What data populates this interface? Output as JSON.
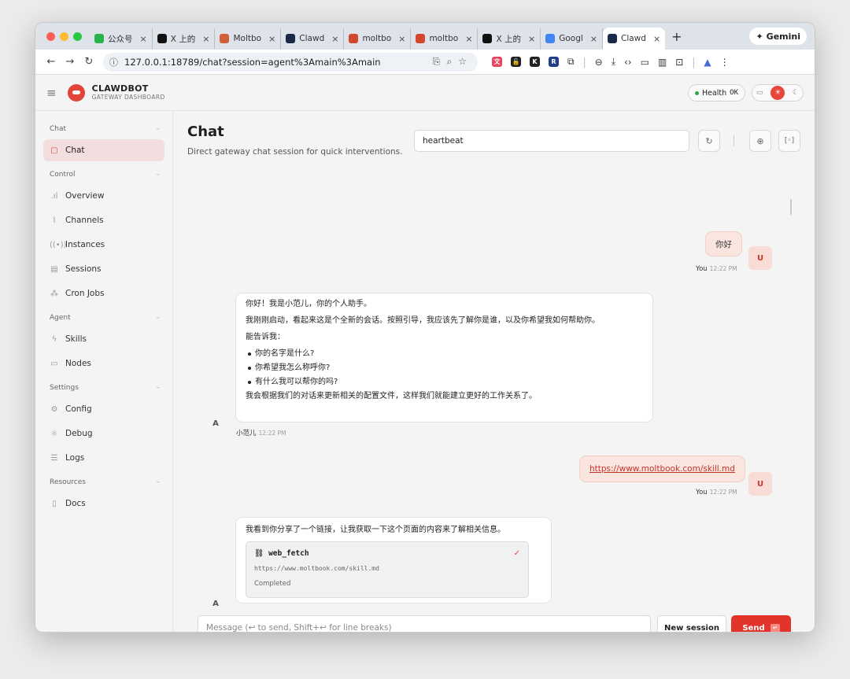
{
  "browser": {
    "tabs": [
      {
        "title": "公众号",
        "icon": "green-swirl-icon",
        "color": "#2bb24c"
      },
      {
        "title": "X 上的",
        "icon": "x-logo-icon",
        "color": "#111111"
      },
      {
        "title": "Moltbo",
        "icon": "moltbook-icon",
        "color": "#d35f3a"
      },
      {
        "title": "Clawd",
        "icon": "clawdbot-icon",
        "color": "#1c2a4a"
      },
      {
        "title": "moltbo",
        "icon": "lobster-icon",
        "color": "#d4472f"
      },
      {
        "title": "moltbo",
        "icon": "lobster-icon",
        "color": "#d4472f"
      },
      {
        "title": "X 上的",
        "icon": "x-logo-icon",
        "color": "#111111"
      },
      {
        "title": "Googl",
        "icon": "gemini-sparkle-icon",
        "color": "#4285f4"
      },
      {
        "title": "Clawd",
        "icon": "clawdbot-icon",
        "color": "#1c2a4a",
        "active": true
      }
    ],
    "gemini_label": "Gemini",
    "url": "127.0.0.1:18789/chat?session=agent%3Amain%3Amain",
    "extensions": [
      {
        "icon": "translate-ext-icon",
        "color": "#e94362",
        "glyph": "文"
      },
      {
        "icon": "lock-ext-icon",
        "color": "#222222",
        "glyph": "🔓"
      },
      {
        "icon": "k-ext-icon",
        "color": "#222222",
        "glyph": "K"
      },
      {
        "icon": "r-ext-icon",
        "color": "#1f3f8a",
        "glyph": "R"
      }
    ]
  },
  "app": {
    "brand_name": "CLAWDBOT",
    "brand_sub": "GATEWAY DASHBOARD",
    "health_label": "Health",
    "health_value": "OK"
  },
  "sidebar": {
    "sections": [
      {
        "title": "Chat",
        "items": [
          {
            "label": "Chat",
            "icon": "chat-bubble-icon",
            "active": true
          }
        ]
      },
      {
        "title": "Control",
        "items": [
          {
            "label": "Overview",
            "icon": "bar-chart-icon"
          },
          {
            "label": "Channels",
            "icon": "link-icon"
          },
          {
            "label": "Instances",
            "icon": "radio-signal-icon"
          },
          {
            "label": "Sessions",
            "icon": "document-icon"
          },
          {
            "label": "Cron Jobs",
            "icon": "spinner-icon"
          }
        ]
      },
      {
        "title": "Agent",
        "items": [
          {
            "label": "Skills",
            "icon": "lightning-icon"
          },
          {
            "label": "Nodes",
            "icon": "monitor-icon"
          }
        ]
      },
      {
        "title": "Settings",
        "items": [
          {
            "label": "Config",
            "icon": "gear-icon"
          },
          {
            "label": "Debug",
            "icon": "bug-icon"
          },
          {
            "label": "Logs",
            "icon": "log-icon"
          }
        ]
      },
      {
        "title": "Resources",
        "items": [
          {
            "label": "Docs",
            "icon": "book-icon"
          }
        ]
      }
    ]
  },
  "chat": {
    "title": "Chat",
    "subtitle": "Direct gateway chat session for quick interventions.",
    "session_value": "heartbeat",
    "messages": {
      "user1": {
        "text": "你好",
        "sender": "You",
        "time": "12:22 PM",
        "avatar": "U"
      },
      "assistant1": {
        "line1": "你好！我是小范儿，你的个人助手。",
        "line2": "我刚刚启动，看起来这是个全新的会话。按照引导，我应该先了解你是谁，以及你希望我如何帮助你。",
        "line3": "能告诉我：",
        "bullets": [
          "你的名字是什么?",
          "你希望我怎么称呼你?",
          "有什么我可以帮你的吗?"
        ],
        "line4": "我会根据我们的对话来更新相关的配置文件，这样我们就能建立更好的工作关系了。",
        "sender": "小范儿",
        "time": "12:22 PM",
        "avatar": "A"
      },
      "user2": {
        "text": "https://www.moltbook.com/skill.md",
        "sender": "You",
        "time": "12:22 PM",
        "avatar": "U"
      },
      "assistant2": {
        "text": "我看到你分享了一个链接，让我获取一下这个页面的内容来了解相关信息。",
        "tool_name": "web_fetch",
        "tool_url": "https://www.moltbook.com/skill.md",
        "tool_status": "Completed",
        "avatar": "A"
      }
    },
    "composer_placeholder": "Message (↩ to send, Shift+↩ for line breaks)",
    "new_session_label": "New session",
    "send_label": "Send",
    "accent_color": "#e2342a"
  }
}
